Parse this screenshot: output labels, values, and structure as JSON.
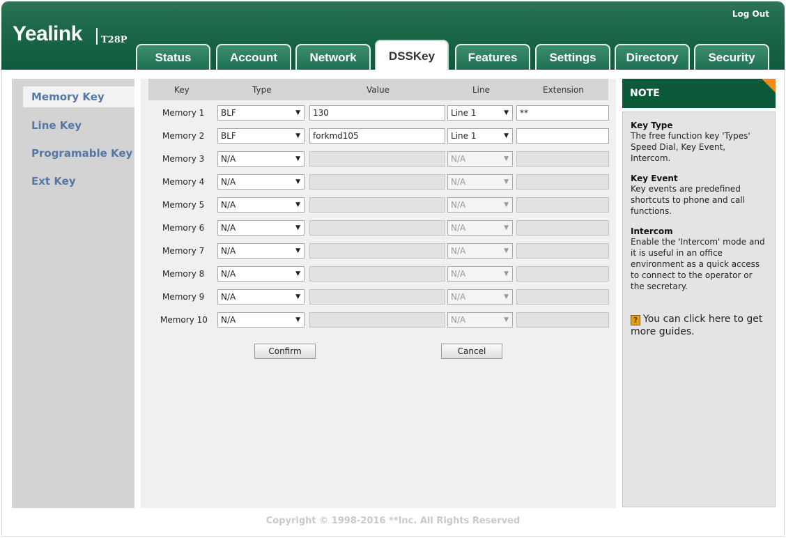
{
  "header": {
    "logo": "Yealink",
    "model": "T28P",
    "logout": "Log Out",
    "tabs": [
      {
        "label": "Status",
        "active": false
      },
      {
        "label": "Account",
        "active": false
      },
      {
        "label": "Network",
        "active": false
      },
      {
        "label": "DSSKey",
        "active": true
      },
      {
        "label": "Features",
        "active": false
      },
      {
        "label": "Settings",
        "active": false
      },
      {
        "label": "Directory",
        "active": false
      },
      {
        "label": "Security",
        "active": false
      }
    ]
  },
  "sidebar": {
    "items": [
      {
        "label": "Memory Key",
        "active": true
      },
      {
        "label": "Line Key",
        "active": false
      },
      {
        "label": "Programable Key",
        "active": false
      },
      {
        "label": "Ext Key",
        "active": false
      }
    ]
  },
  "table": {
    "headers": {
      "key": "Key",
      "type": "Type",
      "value": "Value",
      "line": "Line",
      "extension": "Extension"
    },
    "rows": [
      {
        "key": "Memory 1",
        "type": "BLF",
        "value": "130",
        "line": "Line 1",
        "extension": "**",
        "enabled": true
      },
      {
        "key": "Memory 2",
        "type": "BLF",
        "value": "forkmd105",
        "line": "Line 1",
        "extension": "",
        "enabled": true
      },
      {
        "key": "Memory 3",
        "type": "N/A",
        "value": "",
        "line": "N/A",
        "extension": "",
        "enabled": false
      },
      {
        "key": "Memory 4",
        "type": "N/A",
        "value": "",
        "line": "N/A",
        "extension": "",
        "enabled": false
      },
      {
        "key": "Memory 5",
        "type": "N/A",
        "value": "",
        "line": "N/A",
        "extension": "",
        "enabled": false
      },
      {
        "key": "Memory 6",
        "type": "N/A",
        "value": "",
        "line": "N/A",
        "extension": "",
        "enabled": false
      },
      {
        "key": "Memory 7",
        "type": "N/A",
        "value": "",
        "line": "N/A",
        "extension": "",
        "enabled": false
      },
      {
        "key": "Memory 8",
        "type": "N/A",
        "value": "",
        "line": "N/A",
        "extension": "",
        "enabled": false
      },
      {
        "key": "Memory 9",
        "type": "N/A",
        "value": "",
        "line": "N/A",
        "extension": "",
        "enabled": false
      },
      {
        "key": "Memory 10",
        "type": "N/A",
        "value": "",
        "line": "N/A",
        "extension": "",
        "enabled": false
      }
    ]
  },
  "buttons": {
    "confirm": "Confirm",
    "cancel": "Cancel"
  },
  "note": {
    "title": "NOTE",
    "sections": [
      {
        "title": "Key Type",
        "text": "The free function key 'Types' Speed Dial, Key Event, Intercom."
      },
      {
        "title": "Key Event",
        "text": "Key events are predefined shortcuts to phone and call functions."
      },
      {
        "title": "Intercom",
        "text": "Enable the 'Intercom' mode and it is useful in an office environment as a quick access to connect to the operator or the secretary."
      }
    ],
    "guide_icon": "?",
    "guide": "You can click here to get more guides."
  },
  "footer": "Copyright © 1998-2016 **Inc. All Rights Reserved",
  "colors": {
    "brand_green": "#0c5a3a",
    "link_blue": "#5377a6",
    "note_corner": "#f08a1c"
  }
}
